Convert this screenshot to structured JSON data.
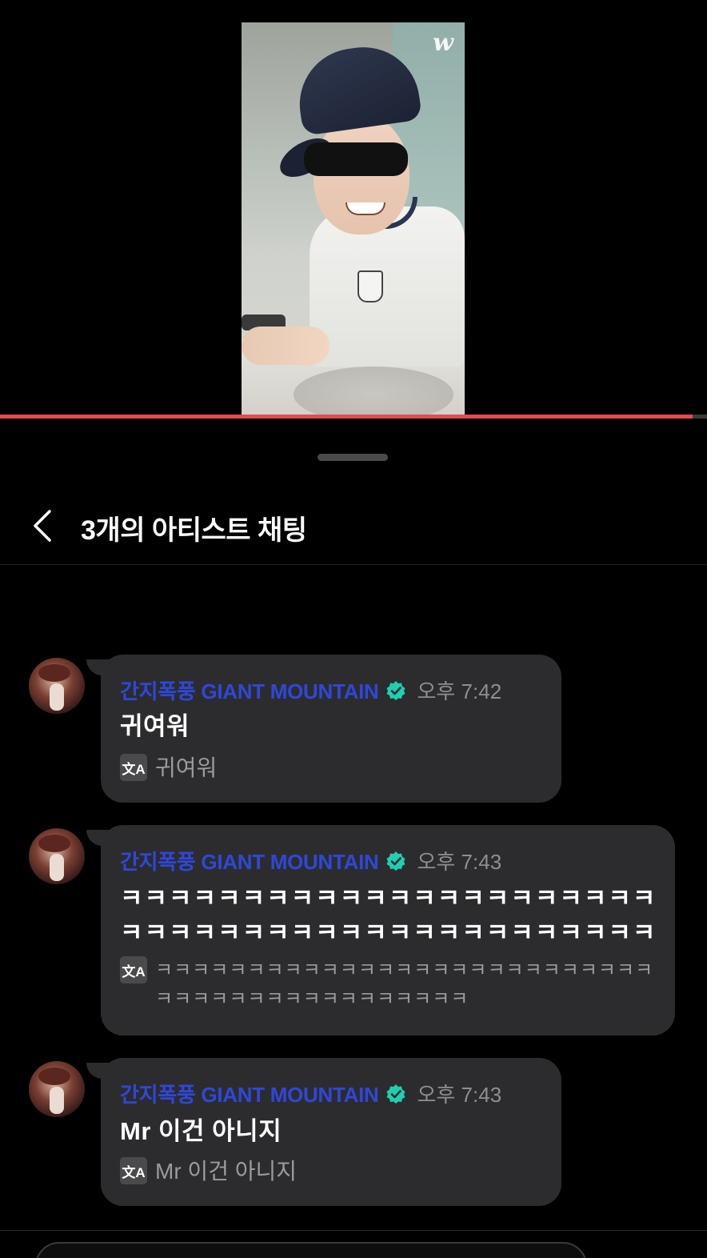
{
  "video": {
    "logo": "w",
    "progress_fraction": 0.98
  },
  "header": {
    "title": "3개의 아티스트 채팅"
  },
  "messages": [
    {
      "author": "간지폭풍 GIANT MOUNTAIN",
      "time": "오후 7:42",
      "text": "귀여워",
      "translation": "귀여워"
    },
    {
      "author": "간지폭풍 GIANT MOUNTAIN",
      "time": "오후 7:43",
      "text": "ㅋㅋㅋㅋㅋㅋㅋㅋㅋㅋㅋㅋㅋㅋㅋㅋㅋㅋㅋㅋㅋㅋㅋㅋㅋㅋㅋㅋㅋㅋㅋㅋㅋㅋㅋㅋㅋㅋㅋㅋㅋㅋㅋㅋ",
      "translation": "ㅋㅋㅋㅋㅋㅋㅋㅋㅋㅋㅋㅋㅋㅋㅋㅋㅋㅋㅋㅋㅋㅋㅋㅋㅋㅋㅋㅋㅋㅋㅋㅋㅋㅋㅋㅋㅋㅋㅋㅋㅋㅋㅋㅋ"
    },
    {
      "author": "간지폭풍 GIANT MOUNTAIN",
      "time": "오후 7:43",
      "text": "Mr 이건 아니지",
      "translation": "Mr 이건 아니지"
    }
  ],
  "icons": {
    "back": "chevron-left-icon",
    "verified": "verified-badge-icon",
    "translate": "translate-icon"
  },
  "colors": {
    "author": "#2f47d8",
    "verified": "#1fcfb0",
    "progress": "#e34b55",
    "bubble": "#2c2c2e"
  },
  "translate_icon_glyph": "文A"
}
